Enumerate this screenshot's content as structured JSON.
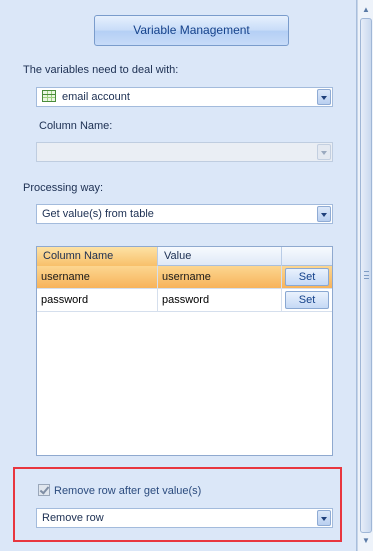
{
  "panel": {
    "title_button": "Variable Management",
    "variables_label": "The variables need to deal with:",
    "variable_combo": {
      "value": "email account",
      "icon": "table-icon"
    },
    "column_name_label": "Column Name:",
    "column_name_combo": {
      "value": ""
    },
    "processing_label": "Processing way:",
    "processing_combo": {
      "value": "Get value(s) from table"
    }
  },
  "grid": {
    "columns": [
      "Column Name",
      "Value",
      ""
    ],
    "rows": [
      {
        "column_name": "username",
        "value": "username",
        "action": "Set",
        "selected": true
      },
      {
        "column_name": "password",
        "value": "password",
        "action": "Set",
        "selected": false
      }
    ]
  },
  "footer": {
    "remove_checkbox_label": "Remove row after get value(s)",
    "remove_checkbox_checked": true,
    "remove_combo": {
      "value": "Remove row"
    }
  },
  "colors": {
    "highlight": "#e8363f",
    "selected_row": "#f7b35a",
    "panel_bg": "#dbe7f8"
  }
}
